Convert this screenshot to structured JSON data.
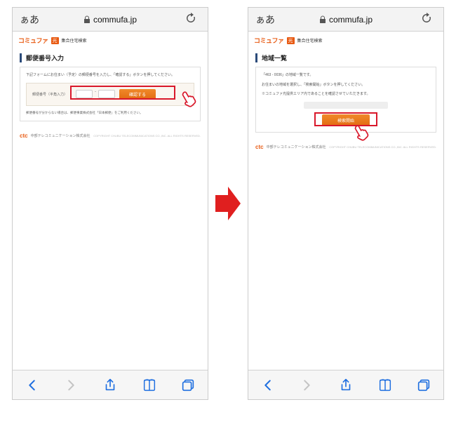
{
  "browser": {
    "reader_button": "ぁあ",
    "domain": "commufa.jp"
  },
  "brand": {
    "logo_text": "コミュファ",
    "badge": "光",
    "subtitle": "集合住宅検索"
  },
  "left_screen": {
    "title": "郵便番号入力",
    "lead": "下記フォームにお住まい（予定）の郵便番号を入力し、「確認する」ボタンを押してください。",
    "input_label": "郵便番号（半角入力）",
    "button": "確認する",
    "hint": "郵便番号が分からない場合は、郵便事業株式会社「日本郵便」をご利用ください。"
  },
  "right_screen": {
    "title": "地域一覧",
    "lead1": "「463 - 0036」の地域一覧です。",
    "lead2": "お住まいの地域を選択し、「検索開始」ボタンを押してください。",
    "lead3": "※コミュファ光提供エリア内であることを確認させていただきます。",
    "button": "検索開始"
  },
  "footer": {
    "ctc": "ctc",
    "company": "中部テレコミュニケーション株式会社",
    "copyright": "COPYRIGHT CHUBU TELECOMMUNICATIONS CO.,INC. ALL RIGHTS RESERVED."
  },
  "colors": {
    "accent": "#e85a12",
    "ios_blue": "#1f6fe0",
    "highlight": "#d9182b"
  }
}
